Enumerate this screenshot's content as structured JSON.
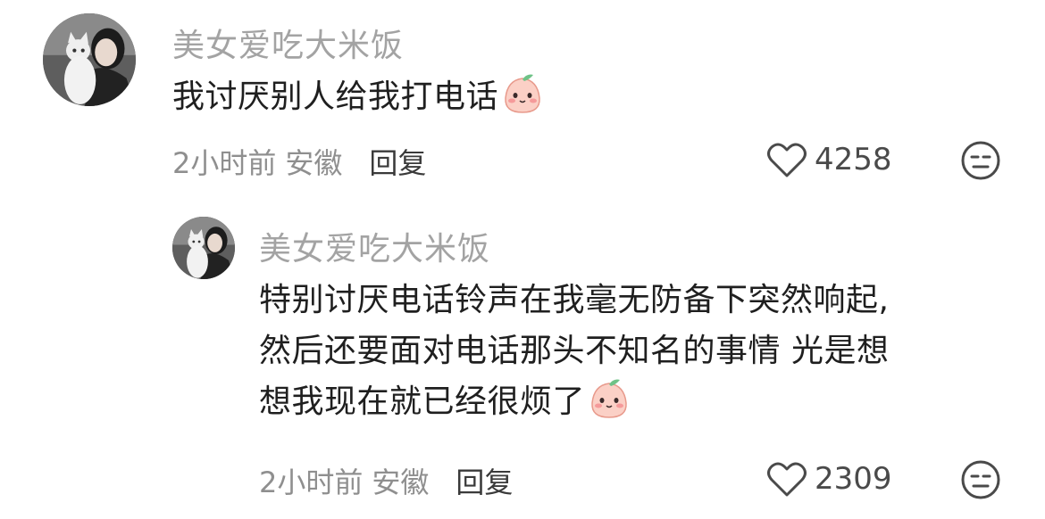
{
  "comments": [
    {
      "username": "美女爱吃大米饭",
      "avatar_icon": "user-avatar-with-cat",
      "content_lines": [
        "我讨厌别人给我打电话"
      ],
      "content_emoji": "peach-face-emoji",
      "time": "2小时前",
      "location": "安徽",
      "reply_label": "回复",
      "like_count": "4258",
      "like_icon": "heart-icon",
      "dislike_icon": "unamused-face-icon"
    },
    {
      "username": "美女爱吃大米饭",
      "avatar_icon": "user-avatar-with-cat",
      "content_lines": [
        "特别讨厌电话铃声在我毫无防备下突然响起,",
        "然后还要面对电话那头不知名的事情 光是想",
        "想我现在就已经很烦了"
      ],
      "content_emoji": "peach-face-emoji",
      "time": "2小时前",
      "location": "安徽",
      "reply_label": "回复",
      "like_count": "2309",
      "like_icon": "heart-icon",
      "dislike_icon": "unamused-face-icon"
    }
  ]
}
